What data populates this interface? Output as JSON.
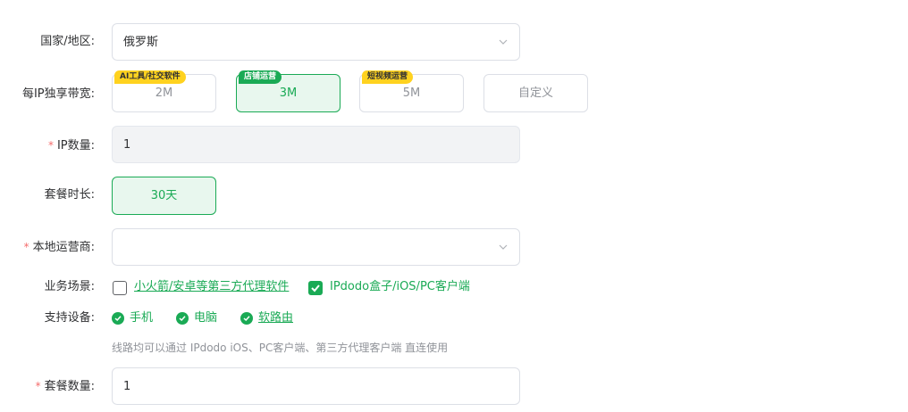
{
  "country": {
    "label": "国家/地区:",
    "value": "俄罗斯"
  },
  "bandwidth": {
    "label": "每IP独享带宽:",
    "options": [
      {
        "label": "2M",
        "tag": "AI工具/社交软件"
      },
      {
        "label": "3M",
        "tag": "店铺运营"
      },
      {
        "label": "5M",
        "tag": "短视频运营"
      },
      {
        "label": "自定义"
      }
    ],
    "selected": "3M"
  },
  "ip_count": {
    "required": "*",
    "label": "IP数量:",
    "value": "1"
  },
  "duration": {
    "label": "套餐时长:",
    "option": "30天"
  },
  "carrier": {
    "required": "*",
    "label": "本地运营商:",
    "value": ""
  },
  "scenario": {
    "label": "业务场景:",
    "options": [
      {
        "label": "小火箭/安卓等第三方代理软件",
        "checked": false
      },
      {
        "label": "IPdodo盒子/iOS/PC客户端",
        "checked": true
      }
    ]
  },
  "devices": {
    "label": "支持设备:",
    "items": [
      "手机",
      "电脑",
      "软路由"
    ],
    "hint": "线路均可以通过 IPdodo iOS、PC客户端、第三方代理客户端 直连使用"
  },
  "package_qty": {
    "required": "*",
    "label": "套餐数量:",
    "value": "1"
  },
  "colors": {
    "accent": "#1aaa55",
    "tag_yellow": "#ffd21f",
    "required": "#f56c6c"
  }
}
